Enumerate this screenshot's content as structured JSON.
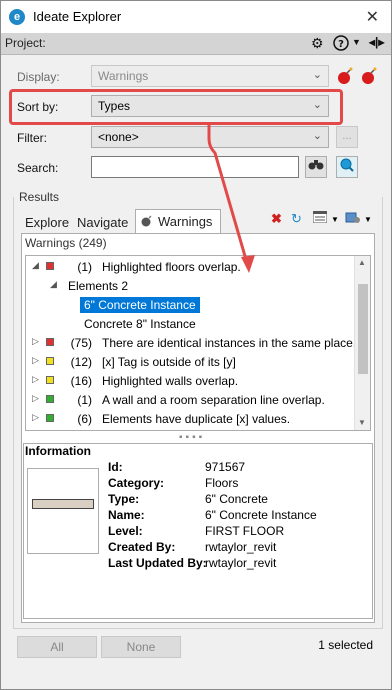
{
  "window": {
    "title": "Ideate Explorer",
    "app_icon": "e"
  },
  "project": {
    "label": "Project:"
  },
  "display": {
    "label": "Display:",
    "value": "Warnings"
  },
  "sort": {
    "label": "Sort by:",
    "value": "Types"
  },
  "filter": {
    "label": "Filter:",
    "value": "<none>",
    "more": "..."
  },
  "search": {
    "label": "Search:",
    "value": ""
  },
  "results": {
    "label": "Results"
  },
  "tabs": [
    {
      "label": "Explore"
    },
    {
      "label": "Navigate"
    },
    {
      "label": "Warnings"
    }
  ],
  "warnings_header": "Warnings (249)",
  "tree": [
    {
      "expanded": true,
      "color": "#e03030",
      "count": "(1)",
      "text": "Highlighted floors overlap."
    },
    {
      "child": true,
      "text": "Elements 2"
    },
    {
      "grandchild": true,
      "selected": true,
      "text": "6\" Concrete Instance"
    },
    {
      "grandchild": true,
      "text": "Concrete 8\" Instance"
    },
    {
      "color": "#e03030",
      "count": "(75)",
      "text": "There are identical instances in the same place."
    },
    {
      "color": "#f0e020",
      "count": "(12)",
      "text": "[x] Tag is outside of its [y]"
    },
    {
      "color": "#f0e020",
      "count": "(16)",
      "text": "Highlighted walls overlap."
    },
    {
      "color": "#30b030",
      "count": "(1)",
      "text": "A wall and a room separation line overlap."
    },
    {
      "color": "#30b030",
      "count": "(6)",
      "text": "Elements have duplicate [x] values."
    }
  ],
  "info": {
    "title": "Information",
    "fields": [
      {
        "k": "Id:",
        "v": "971567"
      },
      {
        "k": "Category:",
        "v": "Floors"
      },
      {
        "k": "Type:",
        "v": "6\" Concrete"
      },
      {
        "k": "Name:",
        "v": "6\" Concrete Instance"
      },
      {
        "k": "Level:",
        "v": "FIRST FLOOR"
      },
      {
        "k": "Created  By:",
        "v": "rwtaylor_revit"
      },
      {
        "k": "Last Updated By:",
        "v": "rwtaylor_revit"
      }
    ]
  },
  "buttons": {
    "all": "All",
    "none": "None"
  },
  "status": "1 selected",
  "colors": {
    "accent": "#0078d7",
    "highlight": "#e24a4a"
  }
}
